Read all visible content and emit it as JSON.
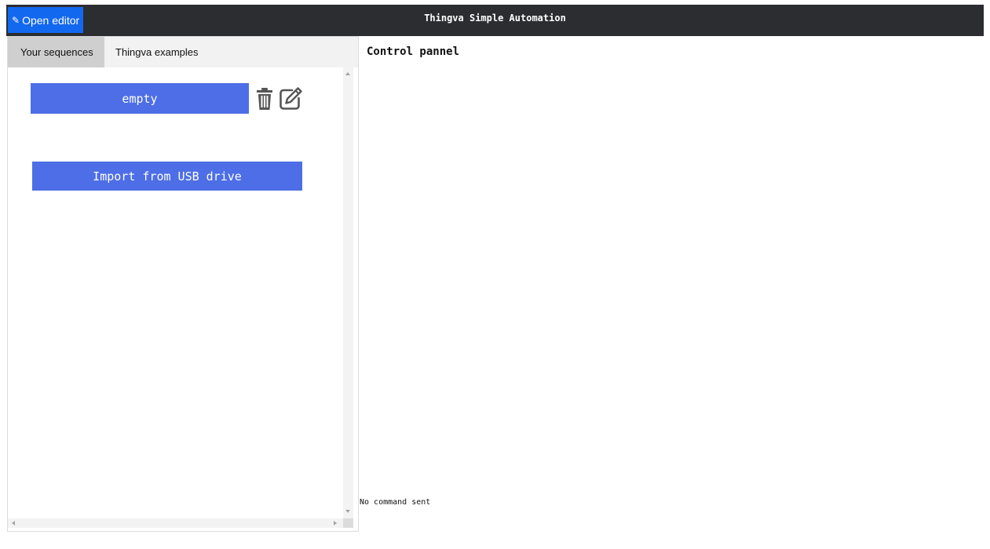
{
  "header": {
    "open_editor_icon": "✎",
    "open_editor_label": "Open editor",
    "title": "Thingva Simple Automation"
  },
  "left_panel": {
    "tabs": [
      {
        "label": "Your sequences",
        "active": true
      },
      {
        "label": "Thingva examples",
        "active": false
      }
    ],
    "sequences": [
      {
        "label": "empty"
      }
    ],
    "import_label": "Import from USB drive"
  },
  "main": {
    "title": "Control pannel",
    "status": "No command sent"
  },
  "colors": {
    "topbar": "#2b2d31",
    "open_editor_bg": "#1368f0",
    "button_bg": "#4d6ee6",
    "icon_gray": "#555555",
    "tab_active": "#cfcfcf",
    "tab_bar": "#f2f2f2"
  },
  "icons": {
    "open_editor": "pencil-icon",
    "delete": "trash-icon",
    "edit": "edit-icon"
  }
}
